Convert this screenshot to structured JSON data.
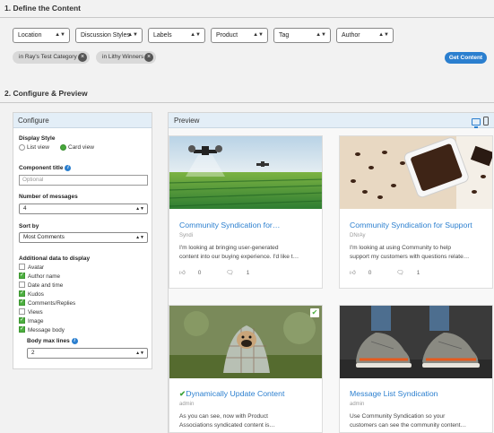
{
  "section1": {
    "title": "1. Define the Content"
  },
  "filters": [
    {
      "label": "Location"
    },
    {
      "label": "Discussion Styles"
    },
    {
      "label": "Labels"
    },
    {
      "label": "Product"
    },
    {
      "label": "Tag"
    },
    {
      "label": "Author"
    }
  ],
  "chips": [
    {
      "label": "in Ray's Test Category"
    },
    {
      "label": "in Lithy Winners"
    }
  ],
  "get_content_label": "Get Content",
  "section2": {
    "title": "2. Configure & Preview"
  },
  "configure": {
    "title": "Configure",
    "display_style_label": "Display Style",
    "list_view_label": "List view",
    "card_view_label": "Card view",
    "display_style_selected": "Card view",
    "component_title_label": "Component title",
    "component_title_placeholder": "Optional",
    "num_messages_label": "Number of messages",
    "num_messages_value": "4",
    "sort_by_label": "Sort by",
    "sort_by_value": "Most Comments",
    "additional_label": "Additional data to display",
    "options": [
      {
        "label": "Avatar",
        "checked": false
      },
      {
        "label": "Author name",
        "checked": true
      },
      {
        "label": "Date and time",
        "checked": false
      },
      {
        "label": "Kudos",
        "checked": true
      },
      {
        "label": "Comments/Replies",
        "checked": true
      },
      {
        "label": "Views",
        "checked": false
      },
      {
        "label": "Image",
        "checked": true
      },
      {
        "label": "Message body",
        "checked": true
      }
    ],
    "body_max_lines_label": "Body max lines",
    "body_max_lines_value": "2"
  },
  "preview": {
    "title": "Preview",
    "cards": [
      {
        "title": "Community Syndication for…",
        "author": "Syndi",
        "body_line1": "I'm looking at bringing user-generated",
        "body_line2": "content into our buying experience. I'd like t…",
        "kudos": "0",
        "comments": "1",
        "image": "drone-field-image"
      },
      {
        "title": "Community Syndication for Support",
        "author": "DNrAy",
        "body_line1": "I'm looking at using Community to help",
        "body_line2": "support my customers with questions relate…",
        "kudos": "0",
        "comments": "1",
        "image": "coffee-beans-image"
      },
      {
        "title": "Dynamically Update Content",
        "author": "admin",
        "body_line1": "As you can see, now with Product",
        "body_line2": "Associations syndicated content is…",
        "image": "pug-blanket-image",
        "selected": true
      },
      {
        "title": "Message List Syndication",
        "author": "admin",
        "body_line1": "Use Community Syndication  so your",
        "body_line2": "customers can see the community content…",
        "image": "sneakers-image"
      }
    ]
  },
  "colors": {
    "accent": "#2b7fcf",
    "check_green": "#4caf3f",
    "panel_header": "#e3eef7"
  }
}
